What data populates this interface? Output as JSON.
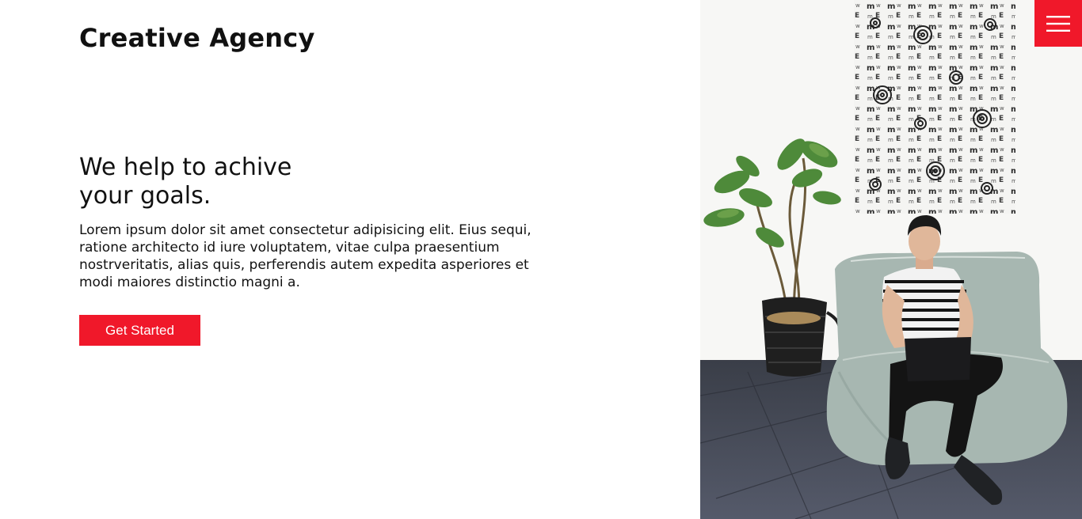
{
  "header": {
    "brand": "Creative Agency",
    "menu_icon": "hamburger-menu-icon"
  },
  "hero": {
    "title": "We help to achive your goals.",
    "description": "Lorem ipsum dolor sit amet consectetur adipisicing elit. Eius sequi, ratione architecto id iure voluptatem, vitae culpa praesentium nostrveritatis, alias quis, perferendis autem expedita asperiores et modi maiores distinctio magni a.",
    "cta_label": "Get Started"
  },
  "photo": {
    "subject": "man-with-laptop-on-beanbag-photo"
  },
  "colors": {
    "accent": "#f0182a",
    "text": "#111111",
    "background": "#ffffff"
  }
}
